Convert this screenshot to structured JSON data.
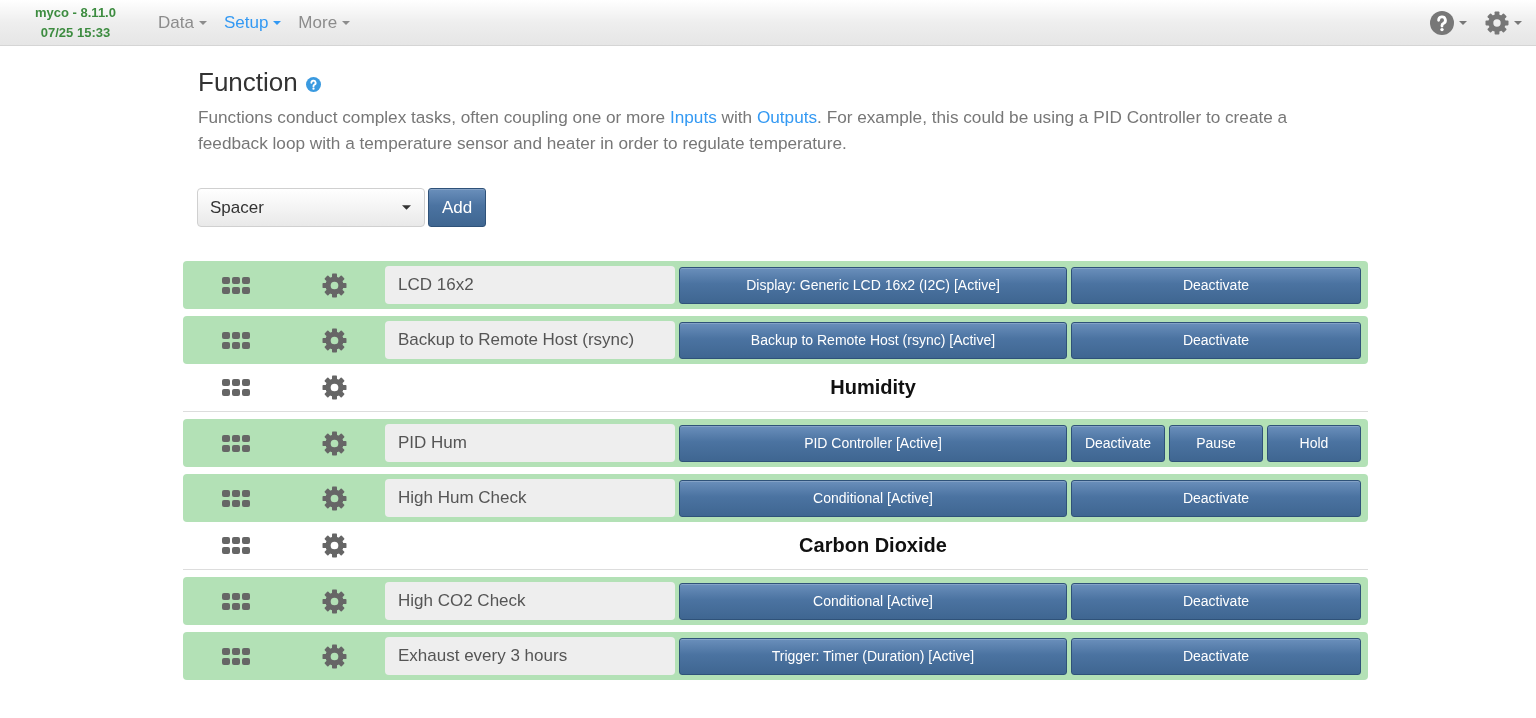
{
  "navbar": {
    "brand": "myco - 8.11.0",
    "datetime": "07/25 15:33",
    "menus": [
      {
        "label": "Data",
        "selected": false
      },
      {
        "label": "Setup",
        "selected": true
      },
      {
        "label": "More",
        "selected": false
      }
    ]
  },
  "page": {
    "title": "Function",
    "description": [
      {
        "kind": "text",
        "text": "Functions conduct complex tasks, often coupling one or more "
      },
      {
        "kind": "link",
        "text": "Inputs"
      },
      {
        "kind": "text",
        "text": " with "
      },
      {
        "kind": "link",
        "text": "Outputs"
      },
      {
        "kind": "text",
        "text": ". For example, this could be using a PID Controller to create a feedback loop with a temperature sensor and heater in order to regulate temperature."
      }
    ]
  },
  "add_form": {
    "type_select": {
      "value": "Spacer"
    },
    "add_button": "Add"
  },
  "functions": [
    {
      "kind": "function",
      "name": "LCD 16x2",
      "active": true,
      "type_button": "Display: Generic LCD 16x2 (I2C) [Active]",
      "actions": [
        "Deactivate"
      ]
    },
    {
      "kind": "function",
      "name": "Backup to Remote Host (rsync)",
      "active": true,
      "type_button": "Backup to Remote Host (rsync) [Active]",
      "actions": [
        "Deactivate"
      ]
    },
    {
      "kind": "spacer",
      "label": "Humidity"
    },
    {
      "kind": "function",
      "name": "PID Hum",
      "active": true,
      "type_button": "PID Controller [Active]",
      "actions": [
        "Deactivate",
        "Pause",
        "Hold"
      ]
    },
    {
      "kind": "function",
      "name": "High Hum Check",
      "active": true,
      "type_button": "Conditional [Active]",
      "actions": [
        "Deactivate"
      ]
    },
    {
      "kind": "spacer",
      "label": "Carbon Dioxide"
    },
    {
      "kind": "function",
      "name": "High CO2 Check",
      "active": true,
      "type_button": "Conditional [Active]",
      "actions": [
        "Deactivate"
      ]
    },
    {
      "kind": "function",
      "name": "Exhaust every 3 hours",
      "active": true,
      "type_button": "Trigger: Timer (Duration) [Active]",
      "actions": [
        "Deactivate"
      ]
    }
  ]
}
